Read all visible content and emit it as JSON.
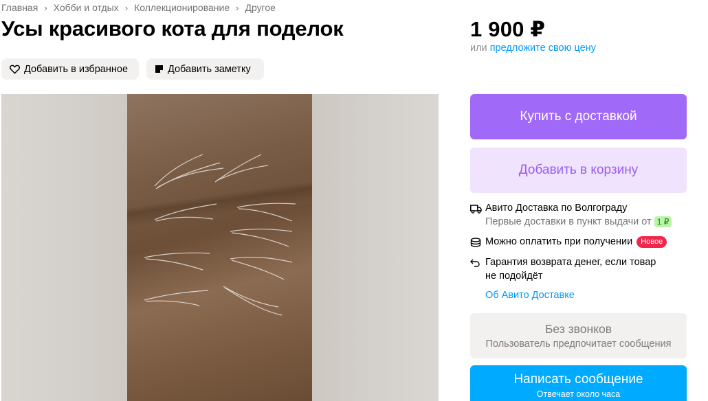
{
  "breadcrumbs": [
    "Главная",
    "Хобби и отдых",
    "Коллекционирование",
    "Другое"
  ],
  "title": "Усы красивого кота для поделок",
  "actions": {
    "favorite_label": "Добавить в избранное",
    "note_label": "Добавить заметку"
  },
  "price": {
    "value": "1 900 ₽",
    "offer_prefix": "или",
    "offer_link": "предложите свою цену"
  },
  "buttons": {
    "buy": "Купить с доставкой",
    "cart": "Добавить в корзину"
  },
  "delivery": {
    "line1": "Авито Доставка по Волгограду",
    "line2": "Первые доставки в пункт выдачи от",
    "line2_badge": "1 ₽",
    "pay_on_receipt": "Можно оплатить при получении",
    "new_badge": "Новое",
    "guarantee_line1": "Гарантия возврата денег, если товар",
    "guarantee_line2": "не подойдёт",
    "about_link": "Об Авито Доставке"
  },
  "contact": {
    "no_calls_title": "Без звонков",
    "no_calls_sub": "Пользователь предпочитает сообщения",
    "message_button": "Написать сообщение",
    "message_sub": "Отвечает около часа"
  },
  "colors": {
    "buy_button": "#a169f7",
    "cart_button": "#efe3fd",
    "message_button": "#00aaff",
    "link": "#0099f7",
    "new_badge": "#f0264a"
  },
  "icons": [
    "heart-icon",
    "note-icon",
    "truck-icon",
    "coins-icon",
    "return-arrow-icon"
  ]
}
